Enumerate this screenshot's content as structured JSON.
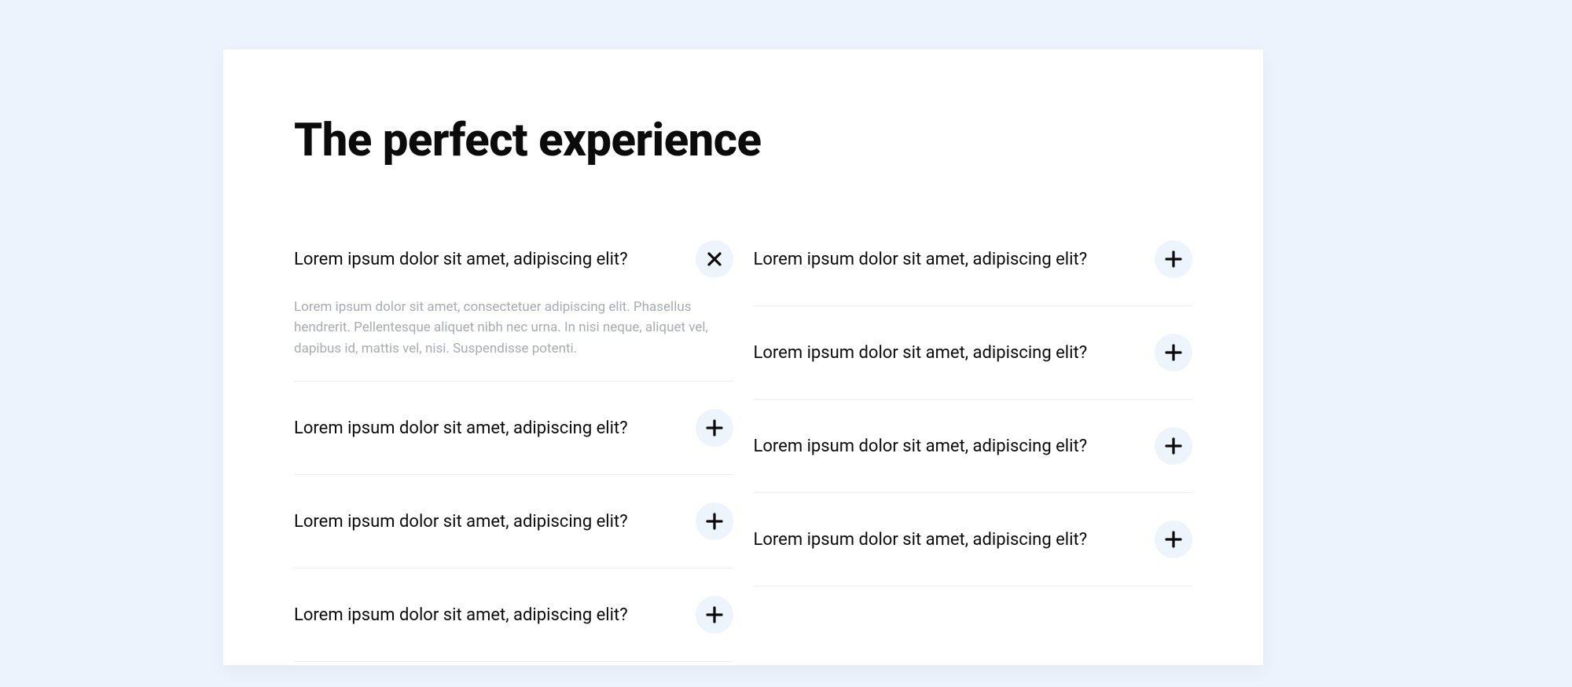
{
  "title": "The perfect experience",
  "left": [
    {
      "question": "Lorem ipsum dolor sit amet, adipiscing elit?",
      "expanded": true,
      "answer": "Lorem ipsum dolor sit amet, consectetuer adipiscing elit. Phasellus hendrerit. Pellentesque aliquet nibh nec urna. In nisi neque, aliquet vel, dapibus id, mattis vel, nisi. Suspendisse potenti."
    },
    {
      "question": "Lorem ipsum dolor sit amet, adipiscing elit?",
      "expanded": false
    },
    {
      "question": "Lorem ipsum dolor sit amet, adipiscing elit?",
      "expanded": false
    },
    {
      "question": "Lorem ipsum dolor sit amet, adipiscing elit?",
      "expanded": false
    }
  ],
  "right": [
    {
      "question": "Lorem ipsum dolor sit amet, adipiscing elit?",
      "expanded": false
    },
    {
      "question": "Lorem ipsum dolor sit amet, adipiscing elit?",
      "expanded": false
    },
    {
      "question": "Lorem ipsum dolor sit amet, adipiscing elit?",
      "expanded": false
    },
    {
      "question": "Lorem ipsum dolor sit amet, adipiscing elit?",
      "expanded": false
    }
  ],
  "icons": {
    "plus": "plus-icon",
    "close": "close-icon"
  }
}
